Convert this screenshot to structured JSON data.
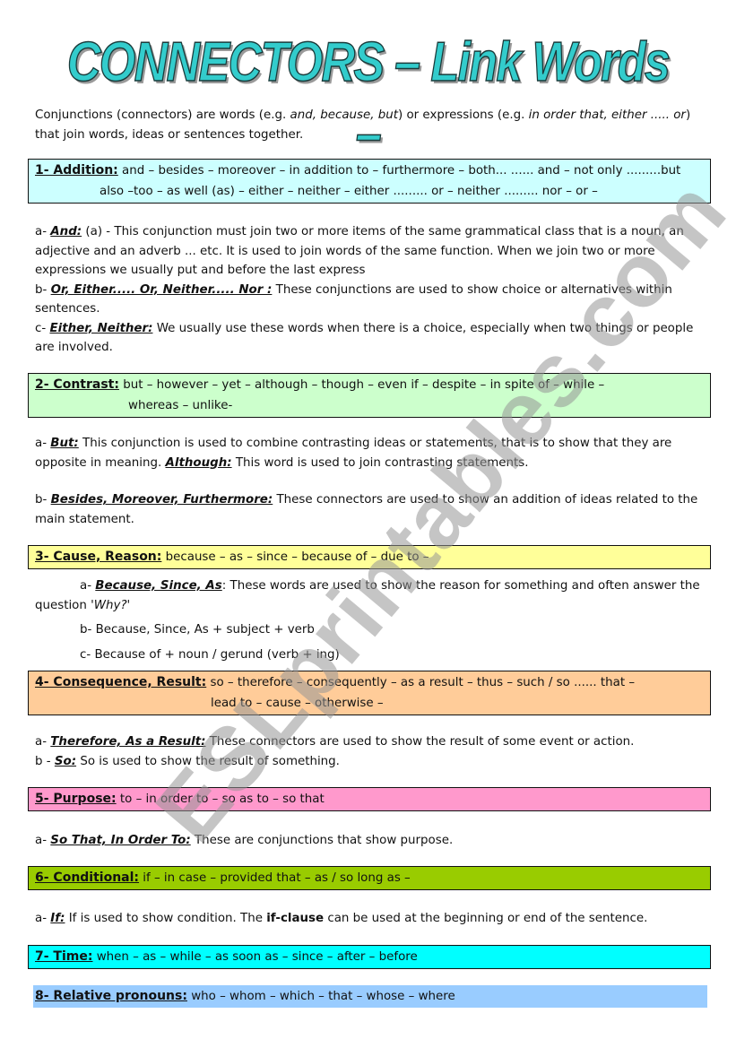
{
  "title": "CONNECTORS – Link Words –",
  "intro": {
    "t1": "Conjunctions (connectors) are words (e.g. ",
    "i1": "and, because, but",
    "t2": ") or expressions (e.g. ",
    "i2": "in order that, either ..... or",
    "t3": ") that join words, ideas or sentences together."
  },
  "colors": {
    "addition": "#ccffff",
    "contrast": "#ccffcc",
    "cause": "#ffff99",
    "consequence": "#ffcc99",
    "purpose": "#ff99cc",
    "conditional": "#99cc00",
    "time": "#00ffff",
    "relative": "#99ccff",
    "title": "#33cccc"
  },
  "sections": {
    "addition": {
      "heading": "1-  Addition:",
      "line1": " and – besides – moreover – in addition to – furthermore – both... ...... and – not only .........but",
      "line2": "also –too – as well (as) – either – neither – either ......... or – neither ......... nor – or –"
    },
    "addition_notes": {
      "a_prefix": "a- ",
      "a_label": "And:",
      "a_text": " (a) - This conjunction must join two or more items of the same grammatical class that is a noun, an adjective and an adverb ... etc. It is used to join words of the same function. When we join two or more expressions we usually put and before the last express",
      "b_prefix": "b- ",
      "b_label": "Or, Either..... Or, Neither..... Nor :",
      "b_text": " These conjunctions are used to show choice or alternatives within sentences.",
      "c_prefix": "c- ",
      "c_label": "Either, Neither:",
      "c_text": " We usually use these words when there is a choice, especially when two things or people are involved."
    },
    "contrast": {
      "heading": "2- Contrast:",
      "line1": " but – however – yet – although – though – even if – despite – in spite of – while –",
      "line2": "whereas – unlike-"
    },
    "contrast_notes": {
      "a_prefix": "a- ",
      "a_label": "But:",
      "a_text": " This conjunction is used to combine contrasting ideas or statements, that is to show that they are opposite in meaning.  ",
      "a_label2": "Although:",
      "a_text2": " This word is used to join contrasting statements.",
      "b_prefix": "b- ",
      "b_label": "Besides, Moreover, Furthermore:",
      "b_text": " These connectors are used to show an addition of ideas related to the main statement."
    },
    "cause": {
      "heading": "3- Cause, Reason:",
      "line1": " because – as – since – because of – due to –"
    },
    "cause_notes": {
      "a_prefix": "a- ",
      "a_label": "Because, Since, As",
      "a_text": ": These words are used to show the reason for something and often answer the question ",
      "a_italic": "'Why?'",
      "b": "b- Because, Since, As + subject + verb",
      "c": "c- Because of + noun / gerund (verb + ing)"
    },
    "consequence": {
      "heading": "4- Consequence, Result:",
      "line1": " so – therefore – consequently – as a result – thus – such / so ...... that –",
      "line2": "lead to – cause – otherwise –"
    },
    "consequence_notes": {
      "a_prefix": "a- ",
      "a_label": "Therefore, As a Result:",
      "a_text": " These connectors are used to show the result of some event or action.",
      "b_prefix": "b - ",
      "b_label": "So:",
      "b_text": " So is used to show the result of something."
    },
    "purpose": {
      "heading": "5- Purpose:",
      "line1": " to – in order to – so as to – so that"
    },
    "purpose_notes": {
      "a_prefix": "a- ",
      "a_label": "So That, In Order To:",
      "a_text": " These are conjunctions that show purpose."
    },
    "conditional": {
      "heading": "6- Conditional:",
      "line1": " if – in case – provided that – as / so long as –"
    },
    "conditional_notes": {
      "a_prefix": "a- ",
      "a_label": "If:",
      "a_text": " If is used to show condition. The ",
      "a_bold": "if-clause",
      "a_text2": " can be used at the beginning or end of the sentence."
    },
    "time": {
      "heading": "7-  Time:",
      "line1": " when – as – while – as soon as – since – after – before"
    },
    "relative": {
      "heading": "8- Relative pronouns:",
      "line1": " who – whom – which – that – whose – where"
    }
  },
  "watermark": "ESLprintables.com"
}
